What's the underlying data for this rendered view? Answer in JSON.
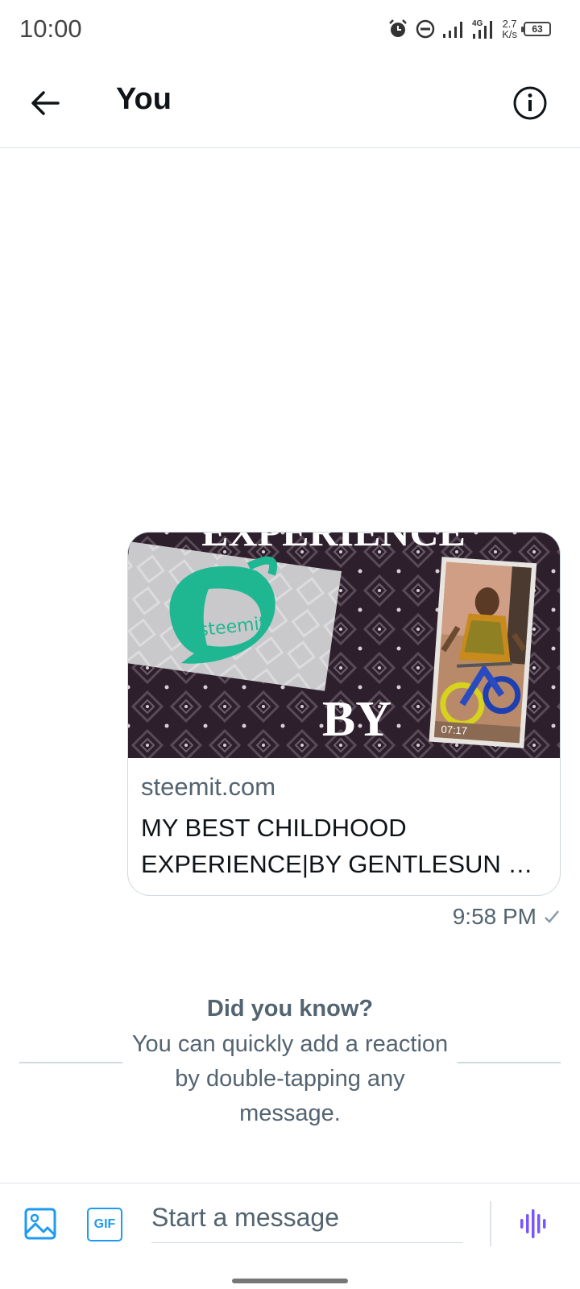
{
  "status_bar": {
    "time": "10:00",
    "network_type": "4G",
    "net_speed_value": "2.7",
    "net_speed_unit": "K/s",
    "battery": "63",
    "icons": [
      "alarm-icon",
      "do-not-disturb-icon",
      "signal-icon",
      "signal-4g-icon",
      "battery-icon"
    ]
  },
  "header": {
    "title": "You",
    "back_icon": "arrow-left-icon",
    "info_icon": "info-icon"
  },
  "message": {
    "image_caption_top": "EXPERIENCE",
    "image_caption_by": "BY",
    "image_logo_text": "steemit",
    "image_photo_timestamp": "07:17",
    "link_domain": "steemit.com",
    "link_title_line1": "MY BEST CHILDHOOD",
    "link_title_line2": "EXPERIENCE|BY GENTLESUN — ...",
    "sent_time": "9:58 PM",
    "status_icon": "checkmark-icon"
  },
  "tip": {
    "heading": "Did you know?",
    "body": "You can quickly add a reaction by double-tapping any message."
  },
  "composer": {
    "placeholder": "Start a message",
    "gif_label": "GIF",
    "media_icon": "image-icon",
    "voice_icon": "voice-wave-icon"
  },
  "colors": {
    "accent": "#1d9bf0",
    "voice": "#7856ff",
    "secondary_text": "#536471",
    "border": "#cfd9de",
    "steemit_green": "#1fb792"
  }
}
